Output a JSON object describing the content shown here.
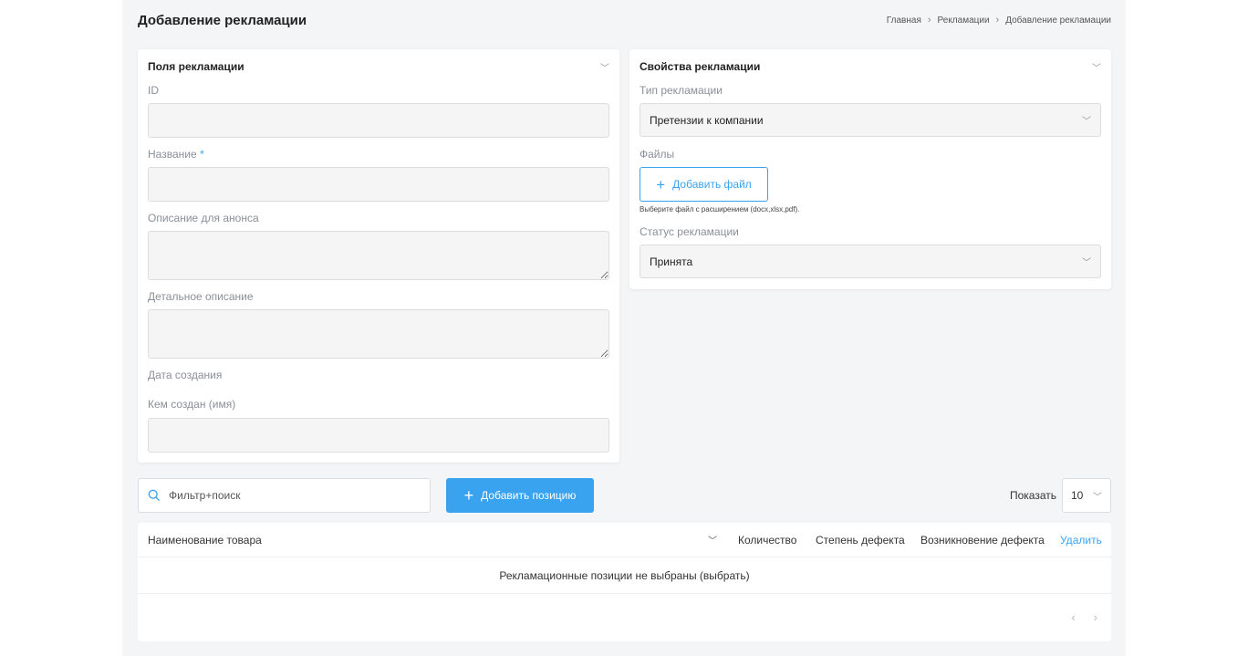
{
  "header": {
    "title": "Добавление рекламации",
    "breadcrumb": [
      "Главная",
      "Рекламации",
      "Добавление рекламации"
    ]
  },
  "fields_card": {
    "title": "Поля рекламации",
    "id_label": "ID",
    "name_label": "Название",
    "required_mark": "*",
    "announce_label": "Описание для анонса",
    "detail_label": "Детальное описание",
    "created_date_label": "Дата создания",
    "created_by_label": "Кем создан (имя)"
  },
  "props_card": {
    "title": "Свойства рекламации",
    "type_label": "Тип рекламации",
    "type_value": "Претензии к компании",
    "files_label": "Файлы",
    "add_file_label": "Добавить файл",
    "file_hint": "Выберите файл с расширением (docx,xlsx,pdf).",
    "status_label": "Статус рекламации",
    "status_value": "Принята"
  },
  "toolbar": {
    "search_placeholder": "Фильтр+поиск",
    "add_position_label": "Добавить позицию",
    "show_label": "Показать",
    "page_size": "10"
  },
  "table": {
    "columns": {
      "name": "Наименование товара",
      "qty": "Количество",
      "degree": "Степень дефекта",
      "occurrence": "Возникновение дефекта",
      "delete": "Удалить"
    },
    "empty_text": "Рекламационные позиции не выбраны (выбрать)"
  },
  "colors": {
    "accent": "#3aa3f0",
    "page_bg": "#f4f5f7"
  },
  "icons": [
    "chevron-down-icon",
    "search-icon",
    "plus-icon",
    "chevron-left-icon",
    "chevron-right-icon"
  ]
}
